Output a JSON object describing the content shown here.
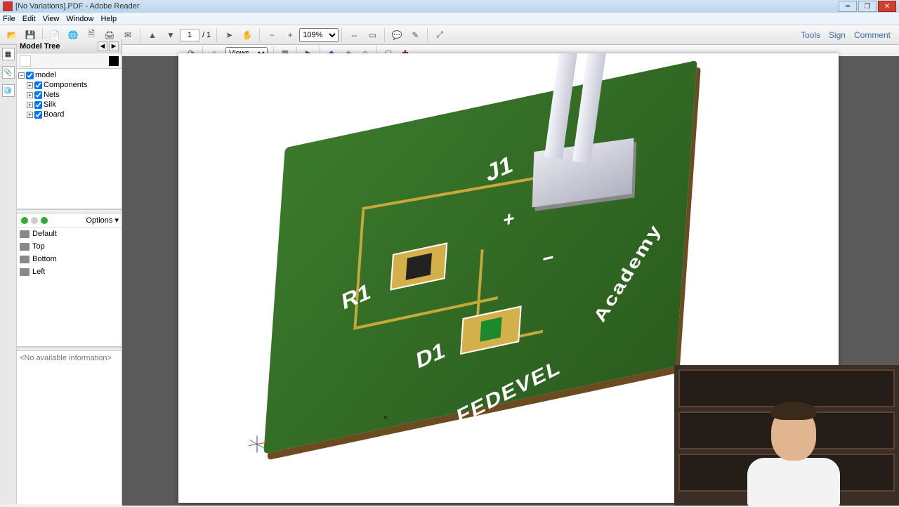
{
  "titlebar": {
    "text": "[No Variations].PDF - Adobe Reader"
  },
  "menu": [
    "File",
    "Edit",
    "View",
    "Window",
    "Help"
  ],
  "page": {
    "current": "1",
    "total": "/ 1"
  },
  "zoom": "109%",
  "right_tabs": {
    "tools": "Tools",
    "sign": "Sign",
    "comment": "Comment"
  },
  "views_label": "Views",
  "panel": {
    "title": "Model Tree",
    "tree": {
      "root": "model",
      "nodes": [
        "Components",
        "Nets",
        "Silk",
        "Board"
      ]
    },
    "options_label": "Options ▾",
    "views": [
      "Default",
      "Top",
      "Bottom",
      "Left"
    ],
    "info": "<No available information>"
  },
  "pcb": {
    "ref_j1": "J1",
    "ref_r1": "R1",
    "ref_d1": "D1",
    "plus": "+",
    "minus": "−",
    "text1": "FEDEVEL",
    "text2": "Academy"
  }
}
